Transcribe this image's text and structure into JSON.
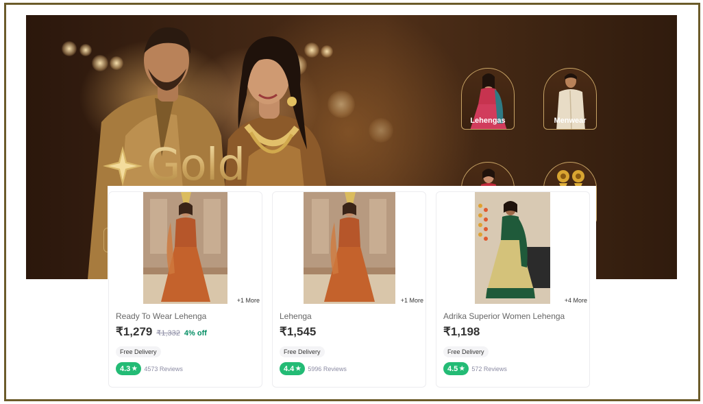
{
  "banner": {
    "brand_word": "Gold",
    "categories": [
      {
        "label": "Lehengas"
      },
      {
        "label": "Menwear"
      }
    ]
  },
  "products": [
    {
      "title": "Ready To Wear Lehenga",
      "price": "₹1,279",
      "mrp": "₹1,332",
      "discount": "4% off",
      "more": "+1 More",
      "delivery": "Free Delivery",
      "rating": "4.3",
      "reviews": "4573 Reviews"
    },
    {
      "title": "Lehenga",
      "price": "₹1,545",
      "more": "+1 More",
      "delivery": "Free Delivery",
      "rating": "4.4",
      "reviews": "5996 Reviews"
    },
    {
      "title": "Adrika Superior Women Lehenga",
      "price": "₹1,198",
      "more": "+4 More",
      "delivery": "Free Delivery",
      "rating": "4.5",
      "reviews": "572 Reviews"
    }
  ],
  "colors": {
    "frame": "#6b5b2a",
    "rating_badge": "#23bb75",
    "discount": "#038d63",
    "banner_gold": "#d9bc7c"
  },
  "icons": [
    "star-icon",
    "sparkle-icon"
  ]
}
